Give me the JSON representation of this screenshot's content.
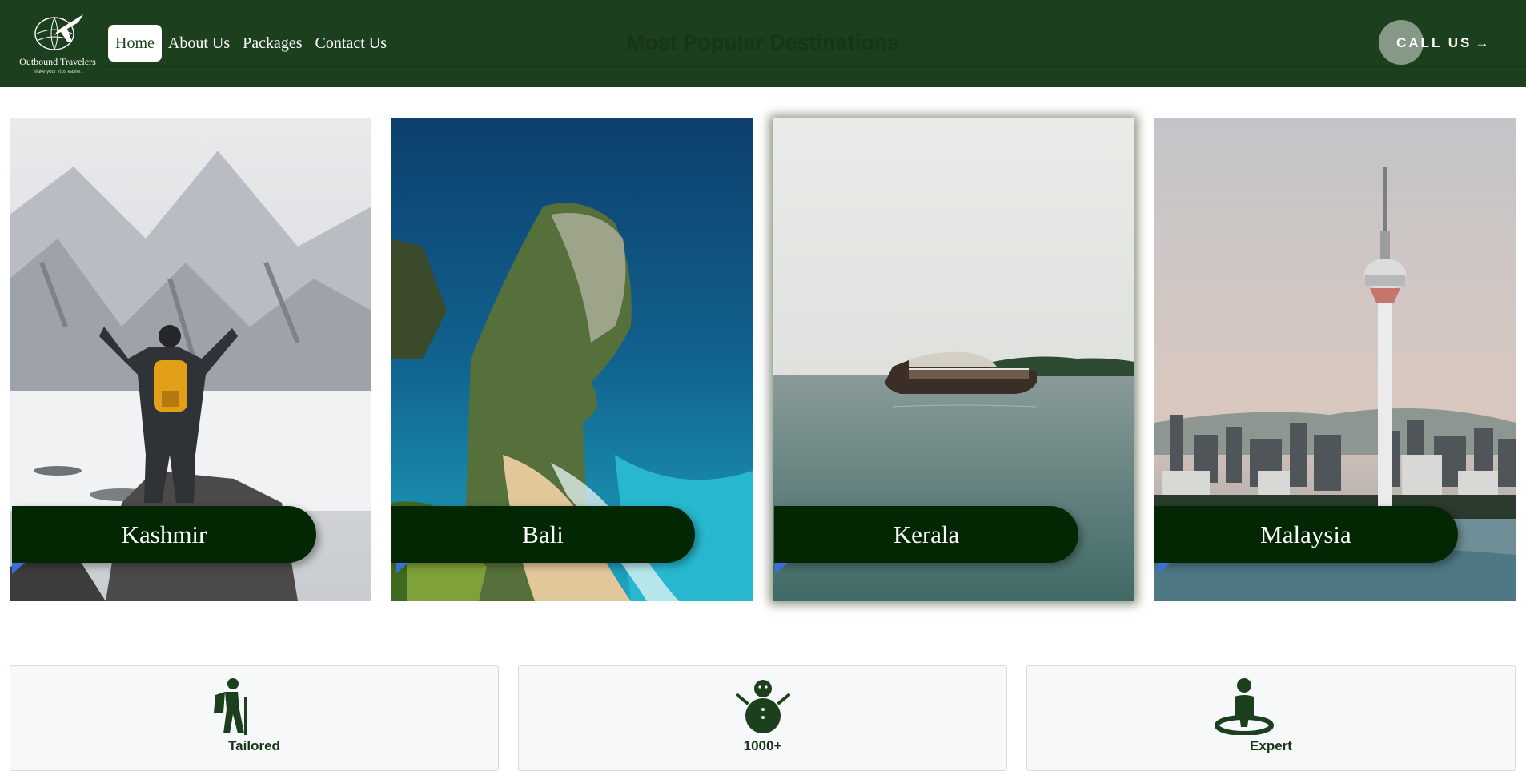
{
  "brand": {
    "name": "Outbound Travelers",
    "tagline": "Make your trips easier."
  },
  "nav": {
    "items": [
      {
        "label": "Home",
        "active": true
      },
      {
        "label": "About Us",
        "active": false
      },
      {
        "label": "Packages",
        "active": false
      },
      {
        "label": "Contact Us",
        "active": false
      }
    ]
  },
  "page_heading": "Most Popular Destinations",
  "call_button": {
    "label": "CALL US",
    "arrow": "→"
  },
  "destinations": [
    {
      "name": "Kashmir",
      "image": "snowy-mountain-hiker-photo"
    },
    {
      "name": "Bali",
      "image": "coastal-cliff-beach-photo"
    },
    {
      "name": "Kerala",
      "image": "houseboat-backwater-photo"
    },
    {
      "name": "Malaysia",
      "image": "kl-tower-skyline-photo"
    }
  ],
  "features": [
    {
      "title": "Tailored",
      "icon": "hiker-icon"
    },
    {
      "title": "1000+",
      "icon": "snowman-icon"
    },
    {
      "title": "Expert",
      "icon": "person-location-icon"
    }
  ],
  "colors": {
    "header_bg": "#1c3f1d",
    "label_bg": "#032703",
    "accent_flag": "#3a6fd8"
  }
}
